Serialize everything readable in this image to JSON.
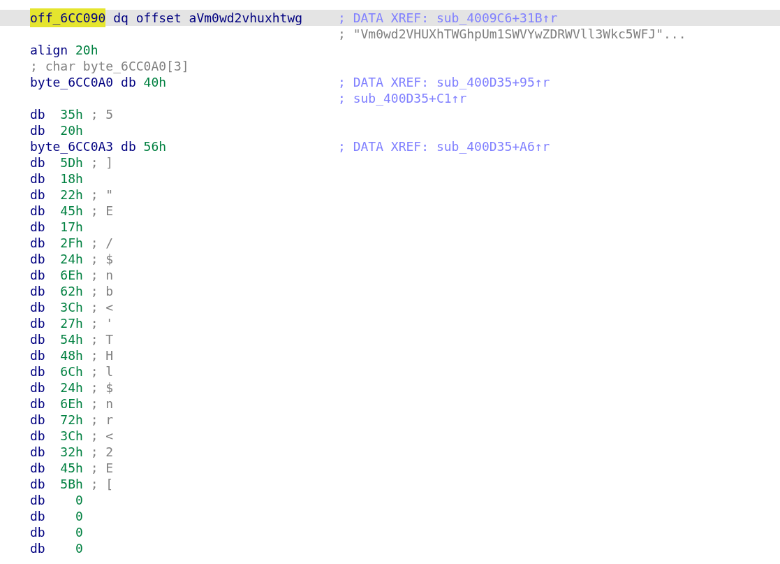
{
  "lines": [
    {
      "kind": "pointer",
      "selected": true,
      "name": "off_6CC090",
      "name_highlighted": true,
      "mnemonic": "dq",
      "operand": "offset aVm0wd2vhuxhtwg",
      "comment": {
        "kind": "xref",
        "text": "; DATA XREF: sub_4009C6+31B↑r"
      }
    },
    {
      "kind": "note",
      "selected": false,
      "comment": {
        "kind": "string",
        "text": "; \"Vm0wd2VHUXhTWGhpUm1SWVYwZDRWVll3Wkc5WFJ\"..."
      }
    },
    {
      "kind": "code",
      "selected": false,
      "mnemonic": "align",
      "operand": "20h"
    },
    {
      "kind": "comment",
      "selected": false,
      "text": "; char byte_6CC0A0[3]"
    },
    {
      "kind": "code",
      "selected": false,
      "name": "byte_6CC0A0",
      "name_highlighted": false,
      "mnemonic": "db",
      "operand": "40h",
      "comment": {
        "kind": "xref",
        "text": "; DATA XREF: sub_400D35+95↑r"
      }
    },
    {
      "kind": "note",
      "selected": false,
      "comment": {
        "kind": "xref",
        "text": "; sub_400D35+C1↑r"
      }
    },
    {
      "kind": "byte",
      "selected": false,
      "mnemonic": "db",
      "operand": "35h",
      "char": "; 5"
    },
    {
      "kind": "byte",
      "selected": false,
      "mnemonic": "db",
      "operand": "20h"
    },
    {
      "kind": "code",
      "selected": false,
      "name": "byte_6CC0A3",
      "name_highlighted": false,
      "mnemonic": "db",
      "operand": "56h",
      "comment": {
        "kind": "xref",
        "text": "; DATA XREF: sub_400D35+A6↑r"
      }
    },
    {
      "kind": "byte",
      "selected": false,
      "mnemonic": "db",
      "operand": "5Dh",
      "char": "; ]"
    },
    {
      "kind": "byte",
      "selected": false,
      "mnemonic": "db",
      "operand": "18h"
    },
    {
      "kind": "byte",
      "selected": false,
      "mnemonic": "db",
      "operand": "22h",
      "char": "; \""
    },
    {
      "kind": "byte",
      "selected": false,
      "mnemonic": "db",
      "operand": "45h",
      "char": "; E"
    },
    {
      "kind": "byte",
      "selected": false,
      "mnemonic": "db",
      "operand": "17h"
    },
    {
      "kind": "byte",
      "selected": false,
      "mnemonic": "db",
      "operand": "2Fh",
      "char": "; /"
    },
    {
      "kind": "byte",
      "selected": false,
      "mnemonic": "db",
      "operand": "24h",
      "char": "; $"
    },
    {
      "kind": "byte",
      "selected": false,
      "mnemonic": "db",
      "operand": "6Eh",
      "char": "; n"
    },
    {
      "kind": "byte",
      "selected": false,
      "mnemonic": "db",
      "operand": "62h",
      "char": "; b"
    },
    {
      "kind": "byte",
      "selected": false,
      "mnemonic": "db",
      "operand": "3Ch",
      "char": "; <"
    },
    {
      "kind": "byte",
      "selected": false,
      "mnemonic": "db",
      "operand": "27h",
      "char": "; '"
    },
    {
      "kind": "byte",
      "selected": false,
      "mnemonic": "db",
      "operand": "54h",
      "char": "; T"
    },
    {
      "kind": "byte",
      "selected": false,
      "mnemonic": "db",
      "operand": "48h",
      "char": "; H"
    },
    {
      "kind": "byte",
      "selected": false,
      "mnemonic": "db",
      "operand": "6Ch",
      "char": "; l"
    },
    {
      "kind": "byte",
      "selected": false,
      "mnemonic": "db",
      "operand": "24h",
      "char": "; $"
    },
    {
      "kind": "byte",
      "selected": false,
      "mnemonic": "db",
      "operand": "6Eh",
      "char": "; n"
    },
    {
      "kind": "byte",
      "selected": false,
      "mnemonic": "db",
      "operand": "72h",
      "char": "; r"
    },
    {
      "kind": "byte",
      "selected": false,
      "mnemonic": "db",
      "operand": "3Ch",
      "char": "; <"
    },
    {
      "kind": "byte",
      "selected": false,
      "mnemonic": "db",
      "operand": "32h",
      "char": "; 2"
    },
    {
      "kind": "byte",
      "selected": false,
      "mnemonic": "db",
      "operand": "45h",
      "char": "; E"
    },
    {
      "kind": "byte",
      "selected": false,
      "mnemonic": "db",
      "operand": "5Bh",
      "char": "; ["
    },
    {
      "kind": "byte",
      "selected": false,
      "mnemonic": "db",
      "operand": "0"
    },
    {
      "kind": "byte",
      "selected": false,
      "mnemonic": "db",
      "operand": "0"
    },
    {
      "kind": "byte",
      "selected": false,
      "mnemonic": "db",
      "operand": "0"
    },
    {
      "kind": "byte",
      "selected": false,
      "mnemonic": "db",
      "operand": "0"
    }
  ]
}
